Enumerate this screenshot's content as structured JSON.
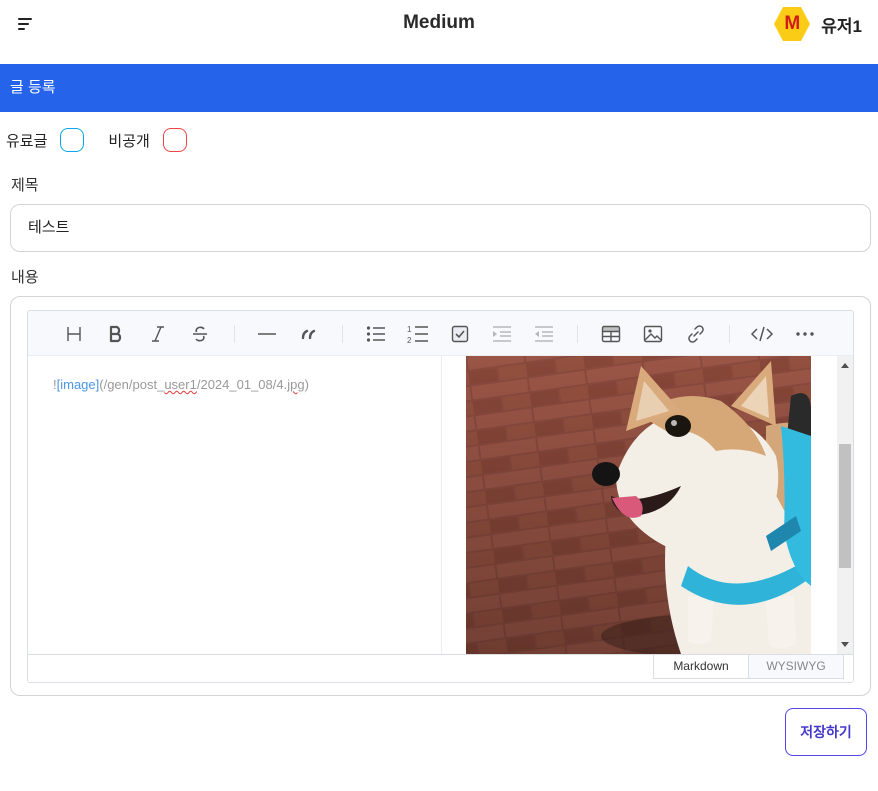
{
  "header": {
    "app_title": "Medium",
    "avatar_letter": "M",
    "username": "유저1",
    "menu_icon": "menu-icon"
  },
  "banner": {
    "title": "글 등록"
  },
  "options": {
    "paid_label": "유료글",
    "private_label": "비공개",
    "paid_checked": false,
    "private_checked": false
  },
  "form": {
    "title_label": "제목",
    "title_value": "테스트",
    "content_label": "내용"
  },
  "editor": {
    "toolbar": [
      "heading-icon",
      "bold-icon",
      "italic-icon",
      "strike-icon",
      "hr-icon",
      "quote-icon",
      "bullet-list-icon",
      "ordered-list-icon",
      "task-list-icon",
      "indent-icon",
      "outdent-icon",
      "table-icon",
      "image-icon",
      "link-icon",
      "code-icon",
      "more-icon"
    ],
    "markdown": {
      "prefix": "!",
      "link_text": "[image]",
      "url_a": "(/gen/post",
      "url_sep": "_",
      "url_b": "user1",
      "url_c": "/2024_01_08/4.",
      "url_d": "jpg",
      "url_e": ")"
    },
    "preview_image": "corgi-photo",
    "mode_markdown": "Markdown",
    "mode_wysiwyg": "WYSIWYG",
    "active_mode": "Markdown"
  },
  "actions": {
    "save_label": "저장하기"
  },
  "colors": {
    "brand_blue": "#2563eb",
    "paid_checkbox": "#0ea5e9",
    "private_checkbox": "#ef4444",
    "save_border": "#4f46e5",
    "avatar_hex": "#facc15"
  }
}
